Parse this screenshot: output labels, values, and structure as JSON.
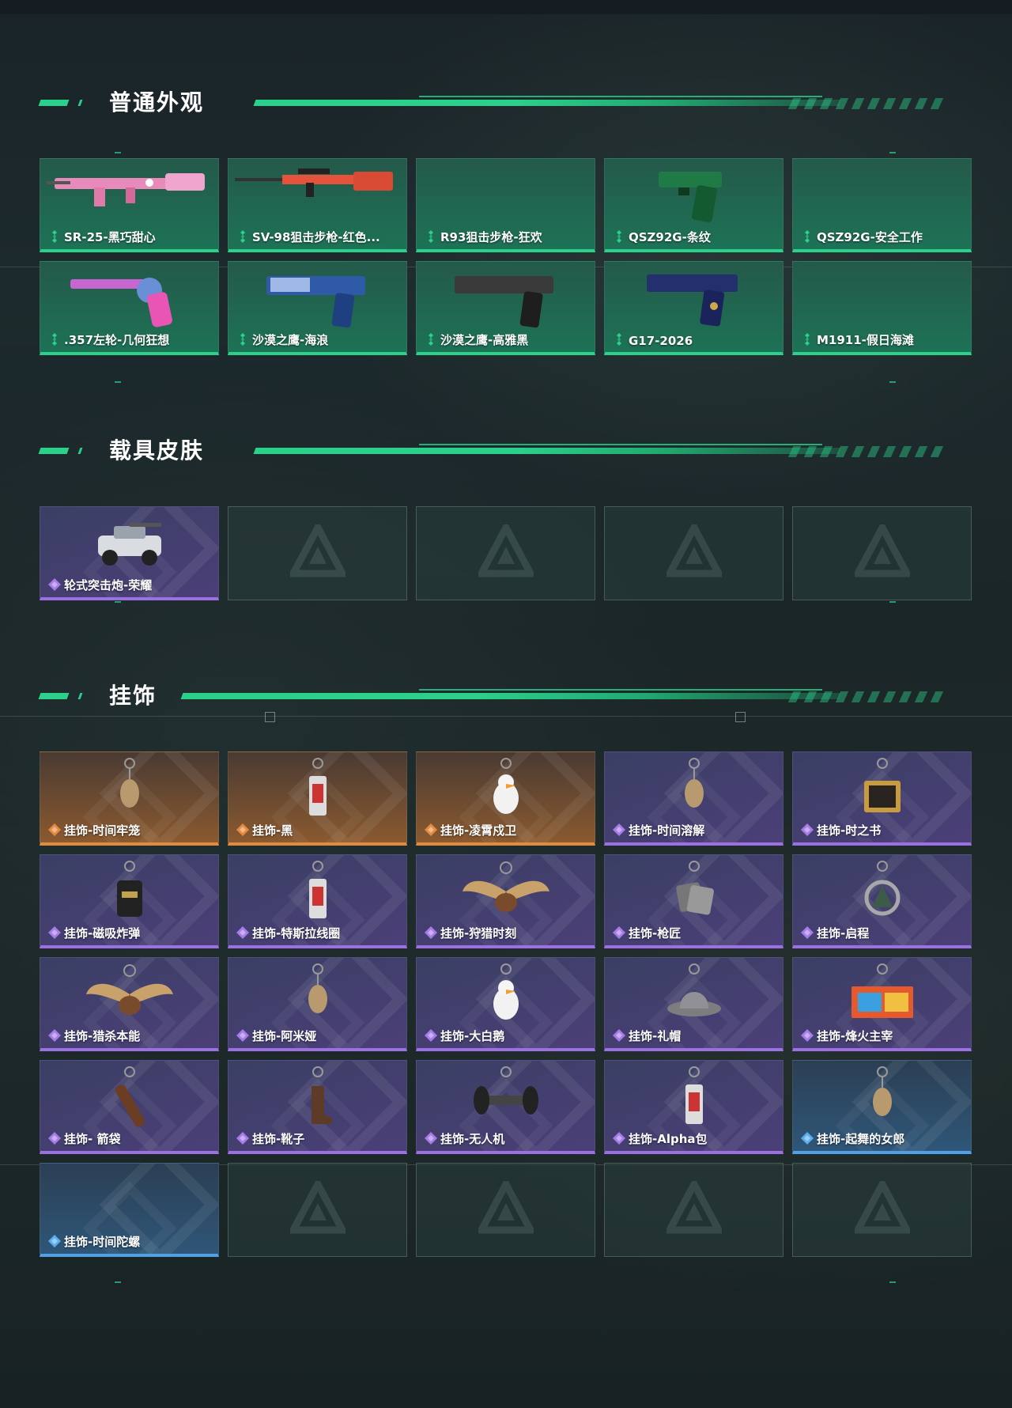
{
  "sections": [
    {
      "title": "普通外观",
      "items": [
        {
          "label": "SR-25-黑巧甜心",
          "rarity": "green",
          "icon": "rifle-pink"
        },
        {
          "label": "SV-98狙击步枪-红色...",
          "rarity": "green",
          "icon": "sniper-red"
        },
        {
          "label": "R93狙击步枪-狂欢",
          "rarity": "green",
          "icon": ""
        },
        {
          "label": "QSZ92G-条纹",
          "rarity": "green",
          "icon": "pistol-green"
        },
        {
          "label": "QSZ92G-安全工作",
          "rarity": "green",
          "icon": ""
        },
        {
          "label": ".357左轮-几何狂想",
          "rarity": "green",
          "icon": "revolver-pink"
        },
        {
          "label": "沙漠之鹰-海浪",
          "rarity": "green",
          "icon": "deagle-blue"
        },
        {
          "label": "沙漠之鹰-高雅黑",
          "rarity": "green",
          "icon": "deagle-black"
        },
        {
          "label": "G17-2026",
          "rarity": "green",
          "icon": "pistol-blue"
        },
        {
          "label": "M1911-假日海滩",
          "rarity": "green",
          "icon": ""
        }
      ]
    },
    {
      "title": "载具皮肤",
      "items": [
        {
          "label": "轮式突击炮-荣耀",
          "rarity": "purple",
          "icon": "vehicle"
        },
        {
          "label": "",
          "rarity": "empty",
          "icon": ""
        },
        {
          "label": "",
          "rarity": "empty",
          "icon": ""
        },
        {
          "label": "",
          "rarity": "empty",
          "icon": ""
        },
        {
          "label": "",
          "rarity": "empty",
          "icon": ""
        }
      ]
    },
    {
      "title": "挂饰",
      "items": [
        {
          "label": "挂饰-时间牢笼",
          "rarity": "gold",
          "icon": "charm"
        },
        {
          "label": "挂饰-黑",
          "rarity": "gold",
          "icon": "charm-tag"
        },
        {
          "label": "挂饰-凌霄戍卫",
          "rarity": "gold",
          "icon": "charm-duck"
        },
        {
          "label": "挂饰-时间溶解",
          "rarity": "purple",
          "icon": "charm"
        },
        {
          "label": "挂饰-时之书",
          "rarity": "purple",
          "icon": "charm-book"
        },
        {
          "label": "挂饰-磁吸炸弹",
          "rarity": "purple",
          "icon": "charm-bomb"
        },
        {
          "label": "挂饰-特斯拉线圈",
          "rarity": "purple",
          "icon": "charm-tag"
        },
        {
          "label": "挂饰-狩猎时刻",
          "rarity": "purple",
          "icon": "charm-antler"
        },
        {
          "label": "挂饰-枪匠",
          "rarity": "purple",
          "icon": "charm-tags"
        },
        {
          "label": "挂饰-启程",
          "rarity": "purple",
          "icon": "charm-ring"
        },
        {
          "label": "挂饰-猎杀本能",
          "rarity": "purple",
          "icon": "charm-antler"
        },
        {
          "label": "挂饰-阿米娅",
          "rarity": "purple",
          "icon": "charm"
        },
        {
          "label": "挂饰-大白鹅",
          "rarity": "purple",
          "icon": "charm-duck"
        },
        {
          "label": "挂饰-礼帽",
          "rarity": "purple",
          "icon": "charm-hat"
        },
        {
          "label": "挂饰-烽火主宰",
          "rarity": "purple",
          "icon": "charm-poster"
        },
        {
          "label": "挂饰- 箭袋",
          "rarity": "purple",
          "icon": "charm-quiver"
        },
        {
          "label": "挂饰-靴子",
          "rarity": "purple",
          "icon": "charm-boot"
        },
        {
          "label": "挂饰-无人机",
          "rarity": "purple",
          "icon": "charm-drone"
        },
        {
          "label": "挂饰-Alpha包",
          "rarity": "purple",
          "icon": "charm-tag"
        },
        {
          "label": "挂饰-起舞的女郎",
          "rarity": "blue",
          "icon": "charm"
        },
        {
          "label": "挂饰-时间陀螺",
          "rarity": "blue",
          "icon": ""
        },
        {
          "label": "",
          "rarity": "empty",
          "icon": ""
        },
        {
          "label": "",
          "rarity": "empty",
          "icon": ""
        },
        {
          "label": "",
          "rarity": "empty",
          "icon": ""
        },
        {
          "label": "",
          "rarity": "empty",
          "icon": ""
        }
      ]
    }
  ],
  "colors": {
    "accent": "#2bd08a",
    "green_border": "#2bd08a",
    "purple_border": "#9c6fe3",
    "gold_border": "#e08b3e",
    "blue_border": "#4fa0e8"
  }
}
